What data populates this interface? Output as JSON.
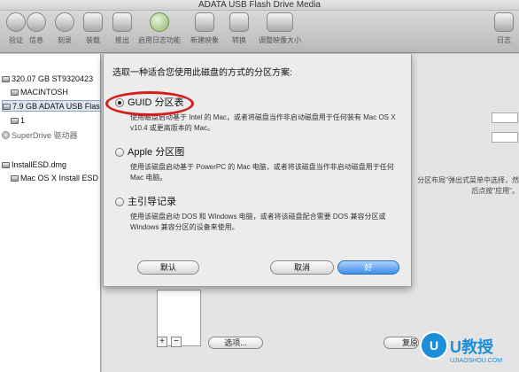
{
  "window": {
    "title": "ADATA USB Flash Drive Media"
  },
  "toolbar": {
    "items": [
      {
        "label": "验证",
        "icon": "verify-icon"
      },
      {
        "label": "信息",
        "icon": "info-icon"
      },
      {
        "label": "刻录",
        "icon": "burn-icon"
      },
      {
        "label": "装载",
        "icon": "mount-icon"
      },
      {
        "label": "推出",
        "icon": "eject-icon"
      },
      {
        "label": "启用日志功能",
        "icon": "journaling-icon"
      },
      {
        "label": "新建映象",
        "icon": "new-image-icon"
      },
      {
        "label": "转换",
        "icon": "convert-icon"
      },
      {
        "label": "调整映像大小",
        "icon": "resize-image-icon"
      },
      {
        "label": "日志",
        "icon": "log-icon"
      }
    ]
  },
  "sidebar": {
    "items": [
      {
        "label": "320.07 GB ST9320423",
        "kind": "drive"
      },
      {
        "label": "MACINTOSH",
        "kind": "volume"
      },
      {
        "label": "7.9 GB ADATA USB Flash",
        "kind": "drive",
        "selected": true
      },
      {
        "label": "1",
        "kind": "volume"
      },
      {
        "label": "SuperDrive 驱动器",
        "kind": "optical"
      },
      {
        "label": "InstallESD.dmg",
        "kind": "image"
      },
      {
        "label": "Mac OS X Install ESD",
        "kind": "volume"
      }
    ]
  },
  "background": {
    "help_text": "分区布局\"弹出式菜单中选择，然后点按\"应用\"。",
    "options_button": "选项...",
    "restore_button": "复原"
  },
  "sheet": {
    "prompt": "选取一种适合您使用此磁盘的方式的分区方案:",
    "options": [
      {
        "title": "GUID 分区表",
        "description": "使用磁盘启动基于 Intel 的 Mac，或者将磁盘当作非启动磁盘用于任何装有 Mac OS X v10.4 或更高版本的 Mac。",
        "selected": true
      },
      {
        "title": "Apple 分区图",
        "description": "使用该磁盘启动基于 PowerPC 的 Mac 电脑，或者将该磁盘当作非启动磁盘用于任何 Mac 电脑。",
        "selected": false
      },
      {
        "title": "主引导记录",
        "description": "使用该磁盘启动 DOS 和 Windows 电脑，或者将该磁盘配合需要 DOS 兼容分区或 Windows 兼容分区的设备来使用。",
        "selected": false
      }
    ],
    "buttons": {
      "default_label": "默认",
      "cancel_label": "取消",
      "ok_label": "好"
    }
  },
  "watermark": {
    "title": "U教授",
    "url": "UJIAOSHOU.COM",
    "badge": "U"
  },
  "colors": {
    "highlight": "#d41e1e",
    "accent": "#3f8ee8"
  }
}
